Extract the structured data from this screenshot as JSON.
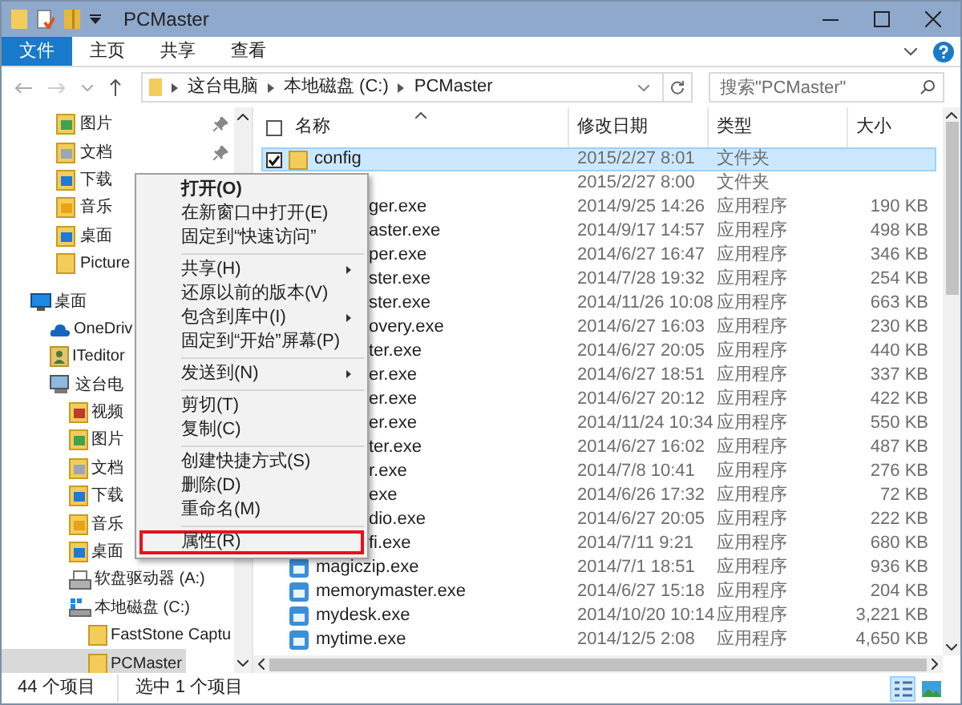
{
  "window": {
    "title": "PCMaster"
  },
  "ribbon": {
    "tabs": [
      {
        "label": "文件",
        "selected": true
      },
      {
        "label": "主页",
        "selected": false
      },
      {
        "label": "共享",
        "selected": false
      },
      {
        "label": "查看",
        "selected": false
      }
    ]
  },
  "address": {
    "crumbs": [
      "这台电脑",
      "本地磁盘 (C:)",
      "PCMaster"
    ],
    "search_placeholder": "搜索\"PCMaster\""
  },
  "nav": {
    "quick_items": [
      {
        "label": "图片",
        "kind": "pictures",
        "pinned": true
      },
      {
        "label": "文档",
        "kind": "documents",
        "pinned": true
      },
      {
        "label": "下载",
        "kind": "downloads",
        "pinned": false
      },
      {
        "label": "音乐",
        "kind": "music",
        "pinned": false
      },
      {
        "label": "桌面",
        "kind": "desktop",
        "pinned": false
      },
      {
        "label": "Picture",
        "kind": "folder",
        "pinned": false
      }
    ],
    "tree": [
      {
        "label": "桌面",
        "kind": "monitor",
        "selected": false,
        "children": [
          {
            "label": "OneDriv",
            "kind": "cloud",
            "selected": false
          },
          {
            "label": "ITeditor",
            "kind": "user",
            "selected": false
          },
          {
            "label": "这台电",
            "kind": "computer",
            "selected": false,
            "children": [
              {
                "label": "视频",
                "kind": "videos",
                "selected": false
              },
              {
                "label": "图片",
                "kind": "pictures",
                "selected": false
              },
              {
                "label": "文档",
                "kind": "documents",
                "selected": false
              },
              {
                "label": "下载",
                "kind": "downloads",
                "selected": false
              },
              {
                "label": "音乐",
                "kind": "music",
                "selected": false
              },
              {
                "label": "桌面",
                "kind": "desktop",
                "selected": false
              },
              {
                "label": "软盘驱动器 (A:)",
                "kind": "floppy",
                "selected": false
              },
              {
                "label": "本地磁盘 (C:)",
                "kind": "disk",
                "selected": false,
                "children": [
                  {
                    "label": "FastStone Captu",
                    "kind": "folder",
                    "selected": false
                  },
                  {
                    "label": "PCMaster",
                    "kind": "folder",
                    "selected": true
                  }
                ]
              }
            ]
          }
        ]
      }
    ]
  },
  "table": {
    "columns": [
      "名称",
      "修改日期",
      "类型",
      "大小"
    ],
    "select_all": {
      "checked": false
    },
    "rows": [
      {
        "kind": "folder",
        "name": "config",
        "date": "2015/2/27 8:01",
        "type": "文件夹",
        "selected": true,
        "checked": true
      },
      {
        "kind": "covered",
        "date": "2015/2/27 8:00",
        "type": "文件夹",
        "selected": false
      },
      {
        "kind": "covered",
        "name": "ger.exe",
        "date": "2014/9/25 14:26",
        "type": "应用程序",
        "size": "190 KB",
        "selected": false
      },
      {
        "kind": "covered",
        "name": "aster.exe",
        "date": "2014/9/17 14:57",
        "type": "应用程序",
        "size": "498 KB",
        "selected": false
      },
      {
        "kind": "covered",
        "name": "per.exe",
        "date": "2014/6/27 16:47",
        "type": "应用程序",
        "size": "346 KB",
        "selected": false
      },
      {
        "kind": "covered",
        "name": "ster.exe",
        "date": "2014/7/28 19:32",
        "type": "应用程序",
        "size": "254 KB",
        "selected": false
      },
      {
        "kind": "covered",
        "name": "ster.exe",
        "date": "2014/11/26 10:08",
        "type": "应用程序",
        "size": "663 KB",
        "selected": false
      },
      {
        "kind": "covered",
        "name": "overy.exe",
        "date": "2014/6/27 16:03",
        "type": "应用程序",
        "size": "230 KB",
        "selected": false
      },
      {
        "kind": "covered",
        "name": "ter.exe",
        "date": "2014/6/27 20:05",
        "type": "应用程序",
        "size": "440 KB",
        "selected": false
      },
      {
        "kind": "covered",
        "name": "er.exe",
        "date": "2014/6/27 18:51",
        "type": "应用程序",
        "size": "337 KB",
        "selected": false
      },
      {
        "kind": "covered",
        "name": "er.exe",
        "date": "2014/6/27 20:12",
        "type": "应用程序",
        "size": "422 KB",
        "selected": false
      },
      {
        "kind": "covered",
        "name": "er.exe",
        "date": "2014/11/24 10:34",
        "type": "应用程序",
        "size": "550 KB",
        "selected": false
      },
      {
        "kind": "covered",
        "name": "ter.exe",
        "date": "2014/6/27 16:02",
        "type": "应用程序",
        "size": "487 KB",
        "selected": false
      },
      {
        "kind": "covered",
        "name": "r.exe",
        "date": "2014/7/8 10:41",
        "type": "应用程序",
        "size": "276 KB",
        "selected": false
      },
      {
        "kind": "covered",
        "name": "exe",
        "date": "2014/6/26 17:32",
        "type": "应用程序",
        "size": "72 KB",
        "selected": false
      },
      {
        "kind": "covered",
        "name": "dio.exe",
        "date": "2014/6/27 20:05",
        "type": "应用程序",
        "size": "222 KB",
        "selected": false
      },
      {
        "kind": "covered",
        "name": "fi.exe",
        "date": "2014/7/11 9:21",
        "type": "应用程序",
        "size": "680 KB",
        "selected": false
      },
      {
        "kind": "app",
        "name": "magiczip.exe",
        "date": "2014/7/1 18:51",
        "type": "应用程序",
        "size": "936 KB",
        "selected": false,
        "checked": false
      },
      {
        "kind": "app",
        "name": "memorymaster.exe",
        "date": "2014/6/27 15:18",
        "type": "应用程序",
        "size": "204 KB",
        "selected": false,
        "checked": false
      },
      {
        "kind": "app",
        "name": "mydesk.exe",
        "date": "2014/10/20 10:14",
        "type": "应用程序",
        "size": "3,221 KB",
        "selected": false,
        "checked": false
      },
      {
        "kind": "app",
        "name": "mytime.exe",
        "date": "2014/12/5 2:08",
        "type": "应用程序",
        "size": "4,650 KB",
        "selected": false,
        "checked": false
      }
    ]
  },
  "context_menu": {
    "items": [
      {
        "kind": "item",
        "label": "打开(O)",
        "bold": true,
        "submenu": false,
        "highlighted": false
      },
      {
        "kind": "item",
        "label": "在新窗口中打开(E)",
        "bold": false,
        "submenu": false,
        "highlighted": false
      },
      {
        "kind": "item",
        "label": "固定到“快速访问”",
        "bold": false,
        "submenu": false,
        "highlighted": false
      },
      {
        "kind": "separator"
      },
      {
        "kind": "item",
        "label": "共享(H)",
        "bold": false,
        "submenu": true,
        "highlighted": false
      },
      {
        "kind": "item",
        "label": "还原以前的版本(V)",
        "bold": false,
        "submenu": false,
        "highlighted": false
      },
      {
        "kind": "item",
        "label": "包含到库中(I)",
        "bold": false,
        "submenu": true,
        "highlighted": false
      },
      {
        "kind": "item",
        "label": "固定到“开始”屏幕(P)",
        "bold": false,
        "submenu": false,
        "highlighted": false
      },
      {
        "kind": "separator"
      },
      {
        "kind": "item",
        "label": "发送到(N)",
        "bold": false,
        "submenu": true,
        "highlighted": false
      },
      {
        "kind": "separator"
      },
      {
        "kind": "item",
        "label": "剪切(T)",
        "bold": false,
        "submenu": false,
        "highlighted": false
      },
      {
        "kind": "item",
        "label": "复制(C)",
        "bold": false,
        "submenu": false,
        "highlighted": false
      },
      {
        "kind": "separator"
      },
      {
        "kind": "item",
        "label": "创建快捷方式(S)",
        "bold": false,
        "submenu": false,
        "highlighted": false
      },
      {
        "kind": "item",
        "label": "删除(D)",
        "bold": false,
        "submenu": false,
        "highlighted": false
      },
      {
        "kind": "item",
        "label": "重命名(M)",
        "bold": false,
        "submenu": false,
        "highlighted": false
      },
      {
        "kind": "separator"
      },
      {
        "kind": "item",
        "label": "属性(R)",
        "bold": false,
        "submenu": false,
        "highlighted": true
      }
    ]
  },
  "status_bar": {
    "count": "44 个项目",
    "selection": "选中 1 个项目",
    "views": [
      {
        "kind": "details",
        "selected": true
      },
      {
        "kind": "thumbnails",
        "selected": false
      }
    ]
  }
}
